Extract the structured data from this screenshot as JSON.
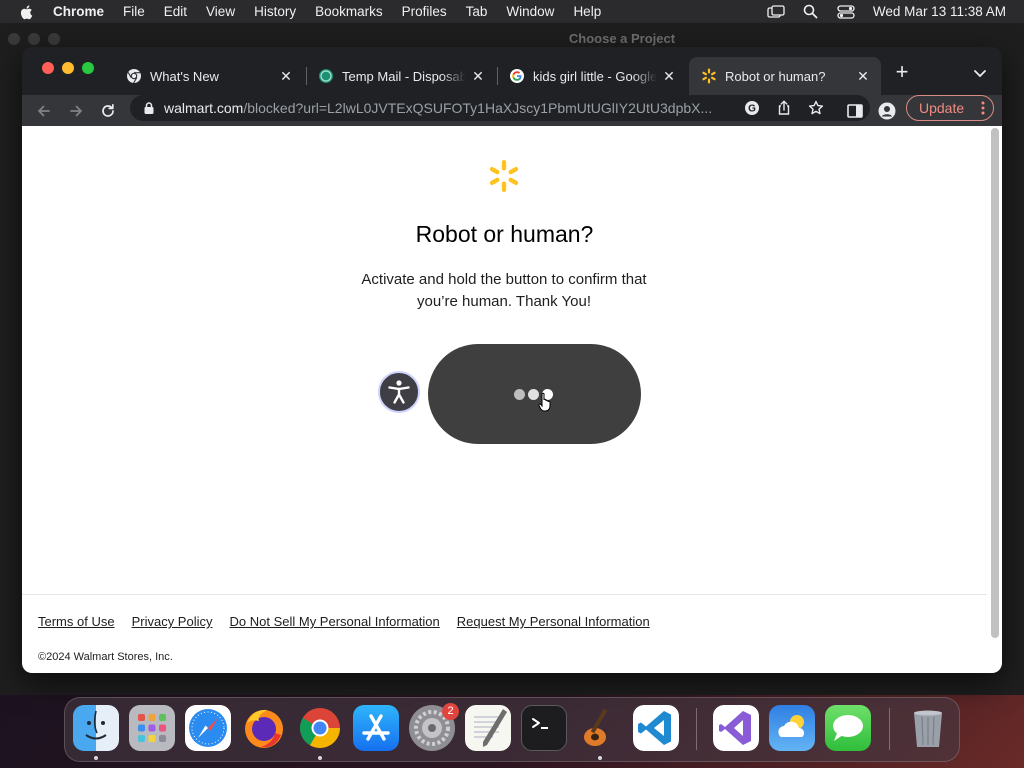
{
  "menubar": {
    "app_name": "Chrome",
    "menus": [
      "File",
      "Edit",
      "View",
      "History",
      "Bookmarks",
      "Profiles",
      "Tab",
      "Window",
      "Help"
    ],
    "clock": "Wed Mar 13  11:38 AM"
  },
  "background_window": {
    "title": "Choose a Project"
  },
  "browser": {
    "tabs": [
      {
        "label": "What's New",
        "icon": "chrome-icon",
        "active": false
      },
      {
        "label": "Temp Mail - Disposable",
        "icon": "temp-mail-icon",
        "active": false
      },
      {
        "label": "kids girl little - Google",
        "icon": "google-icon",
        "active": false
      },
      {
        "label": "Robot or human?",
        "icon": "walmart-spark-icon",
        "active": true
      }
    ],
    "address": {
      "host": "walmart.com",
      "path": "/blocked?url=L2lwL0JVTExQSUFOTy1HaXJscy1PbmUtUGlIY2UtU3dpbX..."
    },
    "update_label": "Update"
  },
  "page": {
    "heading": "Robot or human?",
    "instructions": "Activate and hold the button to confirm that you’re human. Thank You!",
    "footer_links": [
      "Terms of Use",
      "Privacy Policy",
      "Do Not Sell My Personal Information",
      "Request My Personal Information"
    ],
    "copyright": "©2024 Walmart Stores, Inc."
  },
  "dock": {
    "apps": [
      "finder-icon",
      "launchpad-icon",
      "safari-icon",
      "firefox-icon",
      "chrome-icon",
      "app-store-icon",
      "system-settings-icon",
      "textedit-icon",
      "terminal-icon",
      "garageband-icon",
      "vscode-icon",
      "visual-studio-icon",
      "weather-icon",
      "messages-icon",
      "trash-icon"
    ],
    "settings_badge": "2"
  },
  "colors": {
    "walmart_yellow": "#ffc220",
    "hold_button": "#3f3f3f",
    "update_text": "#f28b82"
  }
}
